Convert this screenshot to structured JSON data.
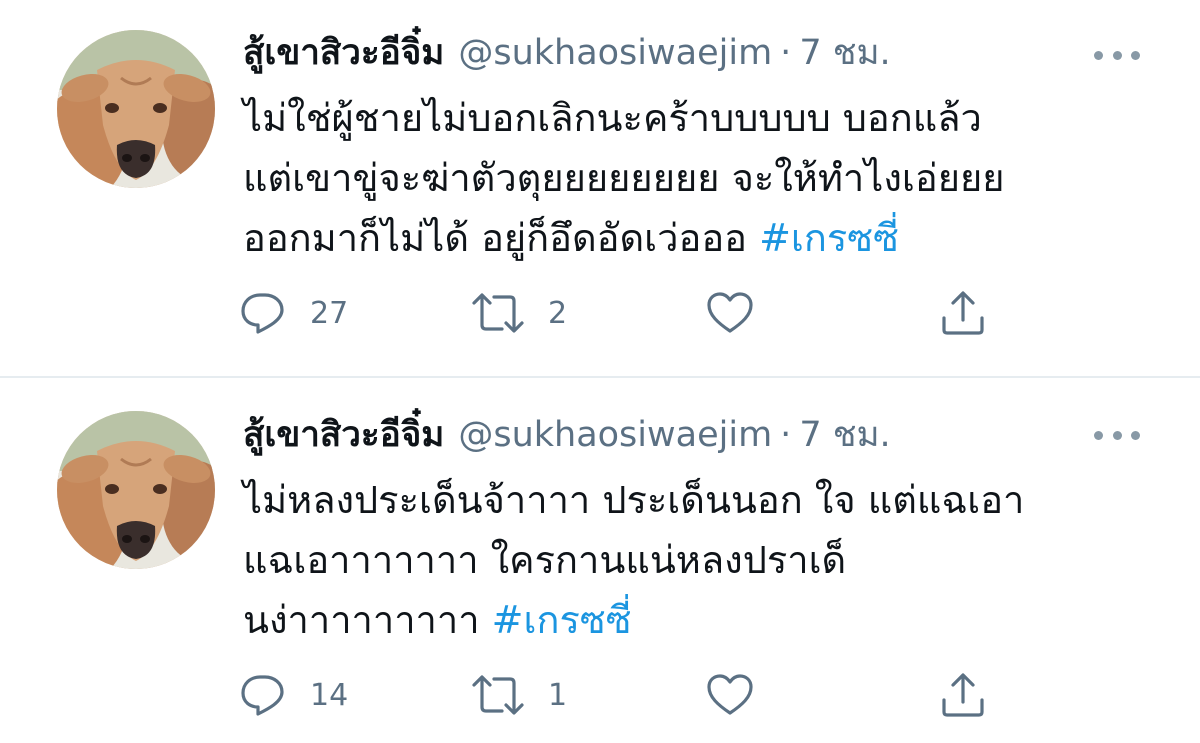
{
  "tweets": [
    {
      "display_name": "สู้เขาสิวะอีจิ๋ม",
      "handle": "@sukhaosiwaejim",
      "separator": "·",
      "time": "7 ชม.",
      "lines": [
        "ไม่ใช่ผู้ชายไม่บอกเลิกนะคร้าบบบบบ บอกแล้ว",
        "แต่เขาขู่จะฆ่าตัวตุยยยยยยยย จะให้ทำไงเอ่ยยย",
        "ออกมาก็ไม่ได้ อยู่ก็อึดอัดเว่อออ"
      ],
      "hashtag": "#เกรซซี่",
      "replies": "27",
      "retweets": "2"
    },
    {
      "display_name": "สู้เขาสิวะอีจิ๋ม",
      "handle": "@sukhaosiwaejim",
      "separator": "·",
      "time": "7 ชม.",
      "lines": [
        "ไม่หลงประเด็นจ้าาาา ประเด็นนอก ใจ แต่แฉเอา",
        "แฉเอาาาาาาา ใครกานแน่หลงปราเด็",
        "นง่าาาาาาาาา"
      ],
      "hashtag": "#เกรซซี่",
      "replies": "14",
      "retweets": "1"
    }
  ],
  "icons": {
    "reply": "reply-icon",
    "retweet": "retweet-icon",
    "like": "heart-icon",
    "share": "share-icon",
    "more": "more-dots-icon"
  },
  "colors": {
    "text": "#0f1419",
    "secondary": "#5b7083",
    "hashtag": "#1b95e0",
    "divider": "#e6ecf0"
  }
}
